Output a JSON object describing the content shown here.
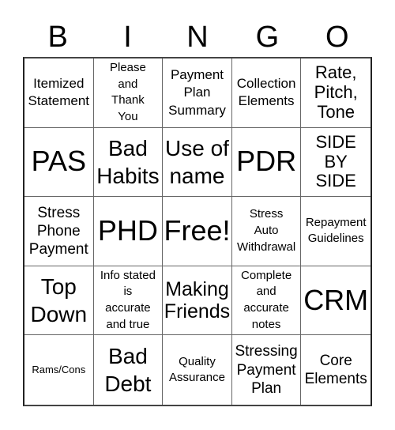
{
  "header": {
    "letters": [
      "B",
      "I",
      "N",
      "G",
      "O"
    ]
  },
  "grid": {
    "rows": [
      [
        {
          "text": "Itemized\nStatement",
          "size": "sm"
        },
        {
          "text": "Please\nand\nThank\nYou",
          "size": "xxs"
        },
        {
          "text": "Payment\nPlan\nSummary",
          "size": "sm"
        },
        {
          "text": "Collection\nElements",
          "size": "sm"
        },
        {
          "text": "Rate,\nPitch,\nTone",
          "size": "l"
        }
      ],
      [
        {
          "text": "PAS",
          "size": "xxl"
        },
        {
          "text": "Bad\nHabits",
          "size": "xl"
        },
        {
          "text": "Use of\nname",
          "size": "xl"
        },
        {
          "text": "PDR",
          "size": "xxl"
        },
        {
          "text": "SIDE\nBY\nSIDE",
          "size": "l"
        }
      ],
      [
        {
          "text": "Stress\nPhone\nPayment",
          "size": "md"
        },
        {
          "text": "PHD",
          "size": "xxl"
        },
        {
          "text": "Free!",
          "size": "xxl"
        },
        {
          "text": "Stress\nAuto\nWithdrawal",
          "size": "xxs"
        },
        {
          "text": "Repayment\nGuidelines",
          "size": "xxs"
        }
      ],
      [
        {
          "text": "Top\nDown",
          "size": "xl"
        },
        {
          "text": "Info stated\nis\naccurate\nand true",
          "size": "xxs"
        },
        {
          "text": "Making\nFriends",
          "size": "lg"
        },
        {
          "text": "Complete\nand\naccurate\nnotes",
          "size": "xxs"
        },
        {
          "text": "CRM",
          "size": "xxl"
        }
      ],
      [
        {
          "text": "Rams/Cons",
          "size": "tiny"
        },
        {
          "text": "Bad\nDebt",
          "size": "xl"
        },
        {
          "text": "Quality\nAssurance",
          "size": "xxs"
        },
        {
          "text": "Stressing\nPayment\nPlan",
          "size": "md"
        },
        {
          "text": "Core\nElements",
          "size": "md"
        }
      ]
    ]
  },
  "free_space_label": "Free!"
}
